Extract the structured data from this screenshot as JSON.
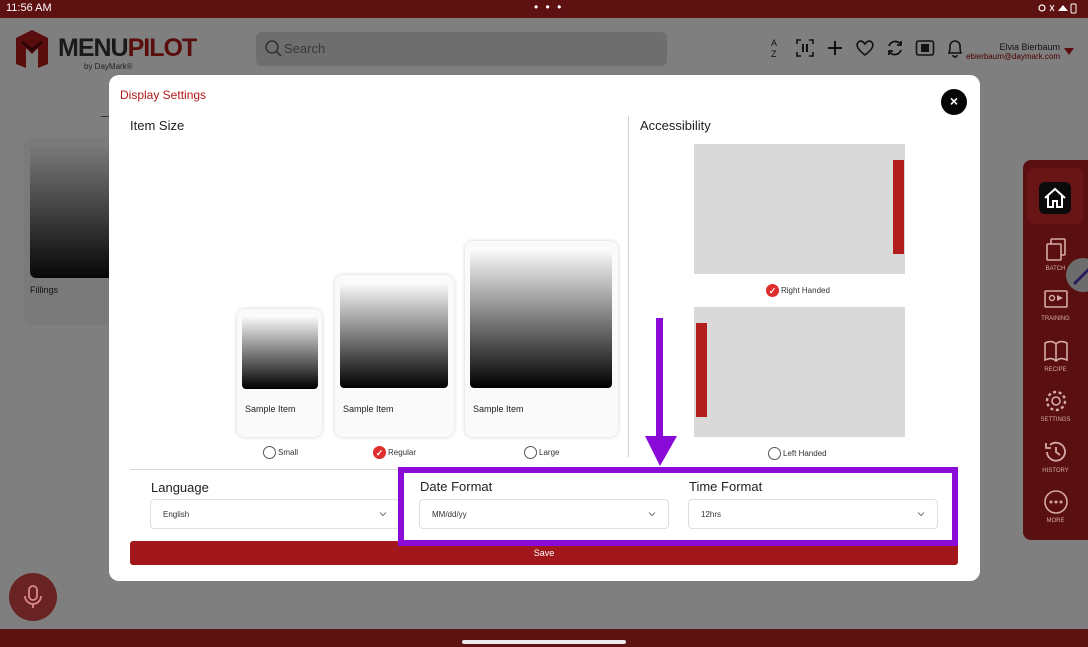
{
  "status_bar": {
    "time": "11:56 AM",
    "dots": "• • •"
  },
  "app": {
    "brand_a": "MENU",
    "brand_b": "PILOT",
    "brand_sub": "by DayMark®",
    "search_placeholder": "Search",
    "user_name": "Elvia Bierbaum",
    "user_email": "ebierbaum@daymark.com",
    "header_icons": [
      "sort-az-icon",
      "scan-icon",
      "plus-icon",
      "heart-icon",
      "sync-icon",
      "print-icon",
      "bell-icon"
    ]
  },
  "background": {
    "card_label": "Fillings"
  },
  "sidenav": {
    "items": [
      {
        "label": "BATCH",
        "icon": "batch-icon"
      },
      {
        "label": "TRAINING",
        "icon": "training-icon"
      },
      {
        "label": "RECIPE",
        "icon": "recipe-icon"
      },
      {
        "label": "SETTINGS",
        "icon": "gear-icon"
      },
      {
        "label": "HISTORY",
        "icon": "history-icon"
      },
      {
        "label": "MORE",
        "icon": "more-icon"
      }
    ]
  },
  "modal": {
    "title": "Display Settings",
    "close_label": "×",
    "item_size": {
      "heading": "Item Size",
      "options": [
        {
          "caption": "Sample Item",
          "label": "Small",
          "selected": false
        },
        {
          "caption": "Sample Item",
          "label": "Regular",
          "selected": true
        },
        {
          "caption": "Sample Item",
          "label": "Large",
          "selected": false
        }
      ]
    },
    "accessibility": {
      "heading": "Accessibility",
      "options": [
        {
          "label": "Right Handed",
          "selected": true
        },
        {
          "label": "Left Handed",
          "selected": false
        }
      ]
    },
    "language": {
      "label": "Language",
      "value": "English"
    },
    "date_format": {
      "label": "Date Format",
      "value": "MM/dd/yy"
    },
    "time_format": {
      "label": "Time Format",
      "value": "12hrs"
    },
    "save_label": "Save"
  },
  "colors": {
    "brand_dark_red": "#5e1111",
    "accent_red": "#a1171b",
    "annotation_purple": "#8a0bd8"
  }
}
